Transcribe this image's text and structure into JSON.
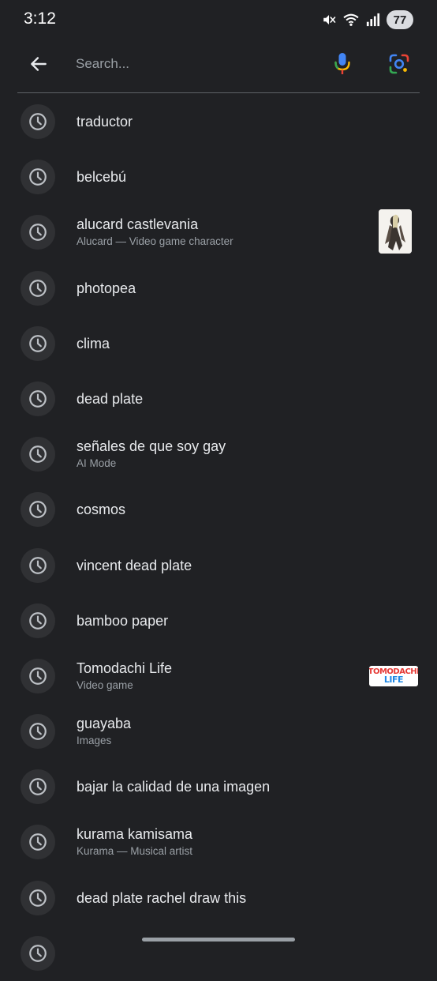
{
  "status_bar": {
    "time": "3:12",
    "battery": "77",
    "icons": [
      "mute-icon",
      "wifi-icon",
      "signal-icon",
      "battery-icon"
    ]
  },
  "search": {
    "placeholder": "Search...",
    "value": ""
  },
  "colors": {
    "background": "#202124",
    "icon_circle": "#303134",
    "text_primary": "#e8eaed",
    "text_secondary": "#9aa0a6",
    "mic_blue": "#4285f4",
    "google_red": "#ea4335",
    "google_yellow": "#fbbc04",
    "google_green": "#34a853"
  },
  "history": [
    {
      "title": "traductor",
      "subtitle": ""
    },
    {
      "title": "belcebú",
      "subtitle": ""
    },
    {
      "title": "alucard castlevania",
      "subtitle": "Alucard — Video game character",
      "thumbnail": "alucard-character-image"
    },
    {
      "title": "photopea",
      "subtitle": ""
    },
    {
      "title": "clima",
      "subtitle": ""
    },
    {
      "title": "dead plate",
      "subtitle": ""
    },
    {
      "title": "señales de que soy gay",
      "subtitle": "AI Mode"
    },
    {
      "title": "cosmos",
      "subtitle": ""
    },
    {
      "title": "vincent dead plate",
      "subtitle": ""
    },
    {
      "title": "bamboo paper",
      "subtitle": ""
    },
    {
      "title": "Tomodachi Life",
      "subtitle": "Video game",
      "thumbnail": "tomodachi-life-logo"
    },
    {
      "title": "guayaba",
      "subtitle": "Images"
    },
    {
      "title": "bajar la calidad de una imagen",
      "subtitle": ""
    },
    {
      "title": "kurama kamisama",
      "subtitle": "Kurama — Musical artist"
    },
    {
      "title": "dead plate rachel draw this",
      "subtitle": ""
    }
  ],
  "tomodachi_logo": {
    "line1": "TOMODACHI",
    "line2": "LIFE"
  }
}
